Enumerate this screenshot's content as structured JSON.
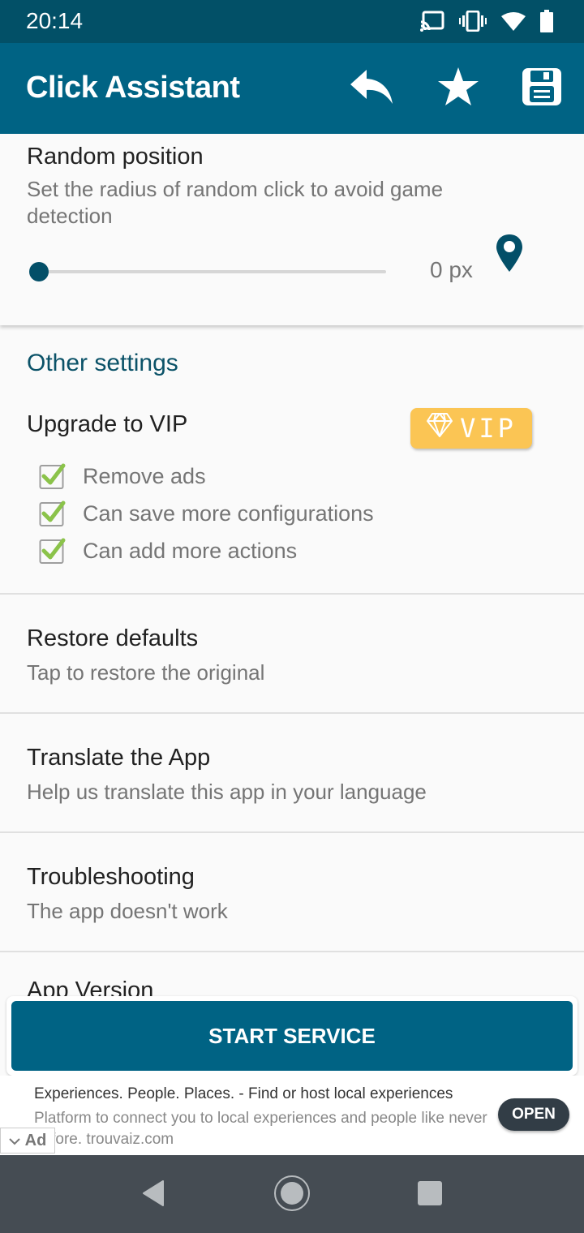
{
  "status_bar": {
    "time": "20:14",
    "icons": [
      "cast-icon",
      "vibrate-icon",
      "wifi-icon",
      "battery-icon"
    ]
  },
  "app_bar": {
    "title": "Click Assistant",
    "actions": [
      "undo-icon",
      "star-icon",
      "save-icon"
    ]
  },
  "random_position": {
    "title": "Random position",
    "subtitle": "Set the radius of random click to avoid game detection",
    "slider_value": 0,
    "slider_value_label": "0 px"
  },
  "other_settings": {
    "header": "Other settings",
    "vip": {
      "title": "Upgrade to VIP",
      "button_label": "VIP",
      "perks": [
        "Remove ads",
        "Can save more configurations",
        "Can add more actions"
      ]
    },
    "items": [
      {
        "title": "Restore defaults",
        "subtitle": "Tap to restore the original"
      },
      {
        "title": "Translate the App",
        "subtitle": "Help us translate this app in your language"
      },
      {
        "title": "Troubleshooting",
        "subtitle": "The app doesn't work"
      }
    ],
    "partial_item_title": "App Version"
  },
  "start_button": {
    "label": "START SERVICE"
  },
  "ad": {
    "headline": "Experiences. People. Places. - Find or host local experiences",
    "body": "Platform to connect you to local experiences and people like never before. trouvaiz.com",
    "cta": "OPEN",
    "badge": "Ad"
  },
  "colors": {
    "primary": "#006384",
    "primary_dark": "#025067",
    "accent_text": "#0b5268",
    "vip": "#fbc554",
    "check": "#8bc34a",
    "nav_bar": "#454c53"
  }
}
